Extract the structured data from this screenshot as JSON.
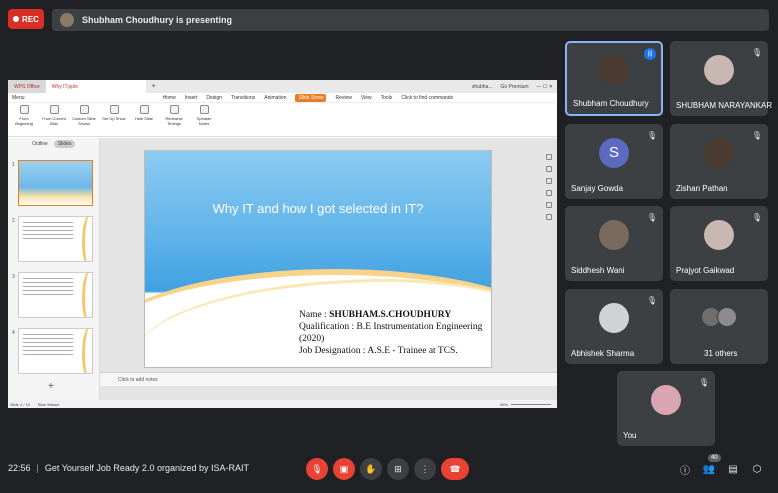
{
  "top": {
    "rec_label": "REC",
    "presenting_text": "Shubham Choudhury is presenting"
  },
  "screen": {
    "tabs": [
      "WPS Office",
      "Why IT.pptx"
    ],
    "tab_right": [
      "shubha...",
      "Go Premium"
    ],
    "menu": [
      "Menu",
      "Home",
      "Insert",
      "Design",
      "Transitions",
      "Animation",
      "Slide Show",
      "Review",
      "View",
      "Tools",
      "Click to find commands"
    ],
    "ribbon": [
      "From Beginning",
      "From Current Slide",
      "Custom Slide Shows",
      "Set Up Show",
      "Hide Slide",
      "Rehearse Timings",
      "Speaker Notes"
    ],
    "panel_tabs": [
      "Outline",
      "Slides"
    ],
    "thumb_numbers": [
      "1",
      "2",
      "3",
      "4"
    ],
    "slide_title": "Why IT and how I got selected in IT?",
    "slide_lines": {
      "name_label": "Name : ",
      "name_value": "SHUBHAM.S.CHOUDHURY",
      "qualification": "Qualification : B.E Instrumentation Engineering (2020)",
      "designation": "Job Designation : A.S.E - Trainee at TCS."
    },
    "notes_placeholder": "Click to add notes",
    "status_left": [
      "Slide 1 / 10",
      "Blue Waves"
    ],
    "zoom": "96%"
  },
  "participants": [
    {
      "name": "Shubham Choudhury",
      "speaking": true
    },
    {
      "name": "SHUBHAM NARAYANKAR",
      "muted": true
    },
    {
      "name": "Sanjay Gowda",
      "initial": "S",
      "muted": true
    },
    {
      "name": "Zishan Pathan",
      "muted": true
    },
    {
      "name": "Siddhesh Wani",
      "muted": true
    },
    {
      "name": "Prajyot Gaikwad",
      "muted": true
    },
    {
      "name": "Abhishek Sharma",
      "muted": true
    },
    {
      "name": "31 others"
    },
    {
      "name": "You",
      "muted": true
    }
  ],
  "bottom": {
    "time": "22:56",
    "separator": "|",
    "meeting_title": "Get Yourself Job Ready 2.0 organized by ISA-RAIT",
    "people_count": "40"
  },
  "icons": {
    "mic_off": "mic-off-icon",
    "cam_off": "camera-off-icon",
    "hand": "raise-hand-icon",
    "present": "present-icon",
    "more": "more-options-icon",
    "end": "end-call-icon",
    "info": "info-icon",
    "people": "people-icon",
    "chat": "chat-icon",
    "activities": "activities-icon"
  },
  "colors": {
    "background": "#202124",
    "tile": "#3c4043",
    "rec": "#d93025",
    "end_call": "#ea4335",
    "speaking": "#1a73e8"
  }
}
